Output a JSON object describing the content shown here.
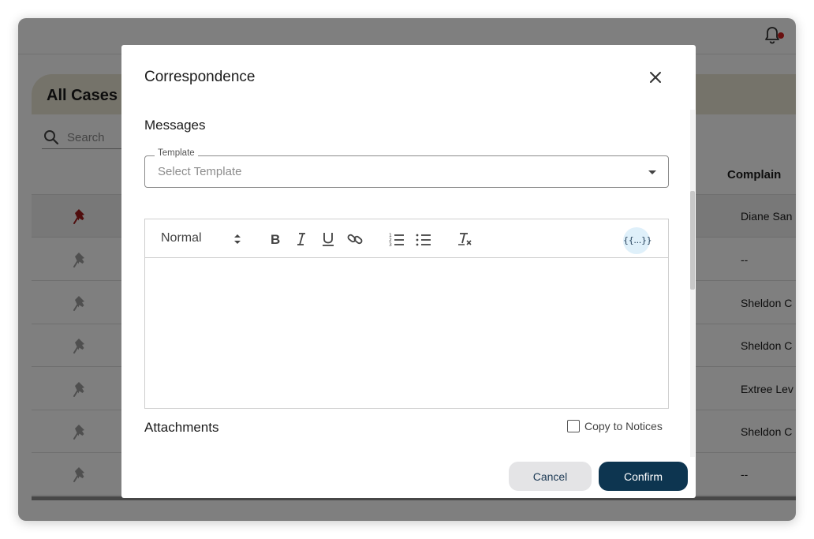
{
  "background": {
    "cases_title": "All Cases",
    "search_placeholder": "Search",
    "column_header": "Complain",
    "rows": [
      {
        "name": "Diane San",
        "pinned": true
      },
      {
        "name": "--",
        "pinned": false
      },
      {
        "name": "Sheldon C",
        "pinned": false
      },
      {
        "name": "Sheldon C",
        "pinned": false
      },
      {
        "name": "Extree Lev",
        "pinned": false
      },
      {
        "name": "Sheldon C",
        "pinned": false
      },
      {
        "name": "--",
        "pinned": false
      }
    ],
    "notification_icon": "bell-icon"
  },
  "modal": {
    "title": "Correspondence",
    "close_icon": "close-icon",
    "messages_label": "Messages",
    "template": {
      "legend": "Template",
      "placeholder": "Select Template"
    },
    "toolbar": {
      "format_value": "Normal",
      "buttons": [
        "bold-icon",
        "italic-icon",
        "underline-icon",
        "link-icon",
        "ordered-list-icon",
        "bullet-list-icon",
        "clear-format-icon"
      ],
      "variables_label": "{{...}}"
    },
    "attachments_label": "Attachments",
    "copy_to_notices_label": "Copy to Notices",
    "copy_to_notices_checked": false,
    "cancel_label": "Cancel",
    "confirm_label": "Confirm"
  },
  "colors": {
    "primary": "#0d3550",
    "pin_active": "#a01b1b",
    "pin_inactive": "#9e9e9e",
    "header_band": "#ebe6d4",
    "notification_dot": "#d21f1f"
  }
}
